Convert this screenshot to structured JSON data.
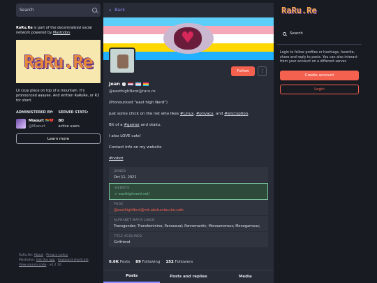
{
  "left": {
    "search_placeholder": "Search",
    "about_name": "RaRu.Re",
    "about_mid": " is part of the decentralized social network powered by ",
    "about_link": "Mastodon",
    "about_end": ".",
    "banner_text": "RaRu.Re",
    "description": "Lil cozy place on top of a mountain. It's pronounced aaayee. And written RaRuRe, or R3 for short.",
    "admin_heading": "ADMINISTERED BY:",
    "admin_name": "Miaourt 🏳️‍🌈💔",
    "admin_handle": "@Miaourt",
    "stats_heading": "SERVER STATS:",
    "stats_number": "80",
    "stats_label": "active users",
    "learn_more": "Learn more",
    "footer_line1_prefix": "RaRu.Re: ",
    "footer_about": "About",
    "footer_sep": " · ",
    "footer_privacy": "Privacy policy",
    "footer_line2_prefix": "Mastodon: ",
    "footer_get_app": "Get the app",
    "footer_shortcuts": "Keyboard shortcuts",
    "footer_source": "View source code",
    "footer_version": "v4.2.10"
  },
  "center": {
    "back_label": "Back",
    "follow_label": "Follow",
    "menu_glyph": "⋮",
    "display_name": "Jean",
    "handle": "@easthighNerd@raru.re",
    "bio": {
      "line1": "(Pronounced \"east high Nerd\")",
      "line2_prefix": "Just some chick on the net who likes ",
      "tag_linux": "#Linux",
      "line2_sep1": ", ",
      "tag_privacy": "#privacy",
      "line2_sep2": ", and ",
      "tag_encryption": "#encryption",
      "line2_end": ".",
      "line3_prefix": "Bit of a ",
      "tag_gamer": "#gamer",
      "line3_end": " and otaku.",
      "line4": "I also LOVE cats!",
      "line5": "Contact info on my website",
      "tag_nobot": "#nobot"
    },
    "fields": [
      {
        "label": "JOINED",
        "value": "Oct 11, 2021"
      },
      {
        "label": "WEBSITE",
        "value": "✔ easthighnerd.net/"
      },
      {
        "label": "PGO2",
        "value": "@easthighNerd@mk.absturztau.be.cafe"
      },
      {
        "label": "ALPHABET MAFIA LINGO",
        "value": "Transgender; Transfeminine; Pansexual; Panromantic; Monoamorous; Monogamous;"
      },
      {
        "label": "TITLE ACQUIRED",
        "value": "Girlfriend"
      }
    ],
    "counts": {
      "posts_num": "6.6K",
      "posts_label": "Posts",
      "following_num": "89",
      "following_label": "Following",
      "followers_num": "152",
      "followers_label": "Followers"
    },
    "tabs": [
      "Posts",
      "Posts and replies",
      "Media"
    ]
  },
  "right": {
    "logo": "RaRu.Re",
    "search_label": "Search",
    "info": "Login to follow profiles or hashtags, favorite, share and reply to posts. You can also interact from your account on a different server.",
    "create_account": "Create account",
    "login": "Login"
  },
  "colors": {
    "accent": "#8c8dff",
    "brand": "#f5614f",
    "verified": "#79bd9a",
    "trans_blue": "#5bcefa",
    "trans_pink": "#f5a9b8",
    "pan_pink": "#ff218c",
    "pan_yellow": "#ffd800",
    "pan_blue": "#21b1ff"
  }
}
